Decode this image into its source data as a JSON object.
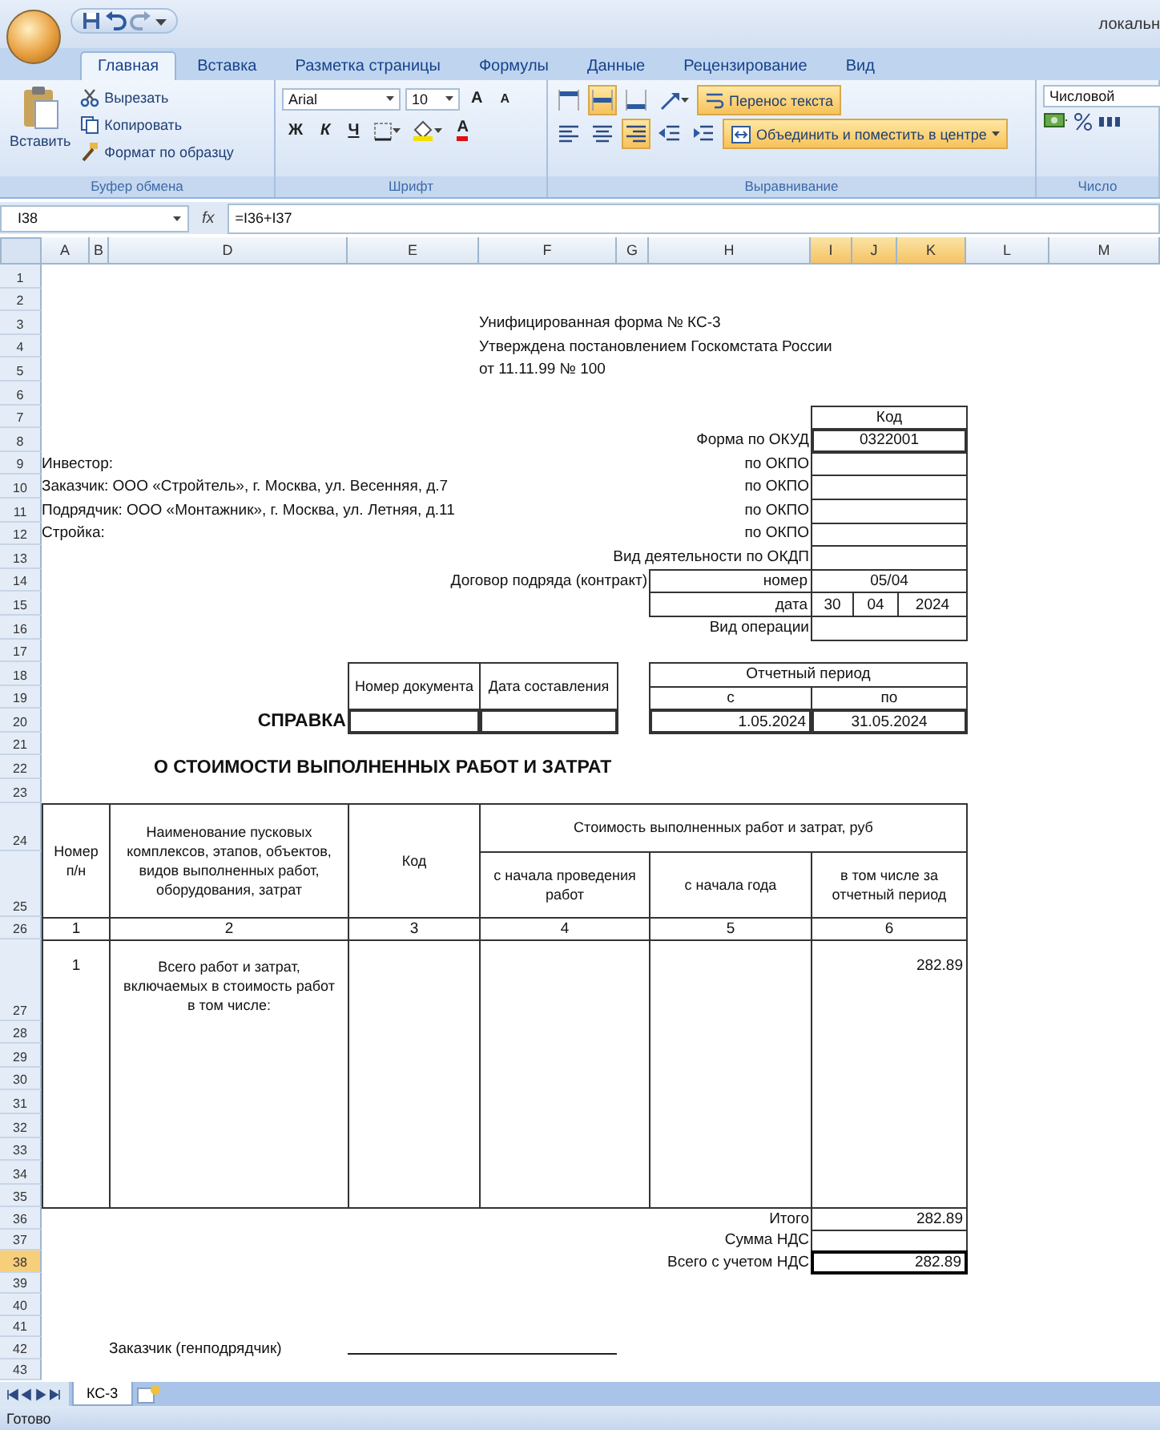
{
  "window": {
    "title": "локальн"
  },
  "ribbon": {
    "tabs": [
      {
        "label": "Главная",
        "selected": true
      },
      {
        "label": "Вставка",
        "selected": false
      },
      {
        "label": "Разметка страницы",
        "selected": false
      },
      {
        "label": "Формулы",
        "selected": false
      },
      {
        "label": "Данные",
        "selected": false
      },
      {
        "label": "Рецензирование",
        "selected": false
      },
      {
        "label": "Вид",
        "selected": false
      }
    ],
    "clipboard": {
      "paste": "Вставить",
      "commands": [
        "Вырезать",
        "Копировать",
        "Формат по образцу"
      ],
      "group": "Буфер обмена"
    },
    "font": {
      "name": "Arial",
      "size": "10",
      "grow": "A",
      "shrink": "A",
      "styles": [
        "Ж",
        "К",
        "Ч"
      ],
      "font_color_label": "A",
      "group": "Шрифт"
    },
    "alignment": {
      "vertical": [
        {
          "selected": false
        },
        {
          "selected": true
        },
        {
          "selected": false
        }
      ],
      "horizontal": [
        {
          "selected": false
        },
        {
          "selected": false
        },
        {
          "selected": true
        }
      ],
      "wrap": {
        "label": "Перенос текста",
        "selected": true
      },
      "merge": {
        "label": "Объединить и поместить в центре",
        "selected": true
      },
      "group": "Выравнивание"
    },
    "number": {
      "format": "Числовой",
      "group": "Число"
    }
  },
  "formula_bar": {
    "name_box": "I38",
    "function_label": "fx",
    "formula": "=I36+I37"
  },
  "columns": [
    {
      "label": "A",
      "selected": false
    },
    {
      "label": "B",
      "selected": false
    },
    {
      "label": "D",
      "selected": false
    },
    {
      "label": "E",
      "selected": false
    },
    {
      "label": "F",
      "selected": false
    },
    {
      "label": "G",
      "selected": false
    },
    {
      "label": "H",
      "selected": false
    },
    {
      "label": "I",
      "selected": true
    },
    {
      "label": "J",
      "selected": true
    },
    {
      "label": "K",
      "selected": true
    },
    {
      "label": "L",
      "selected": false
    },
    {
      "label": "M",
      "selected": false
    }
  ],
  "rows": [
    {
      "label": "1",
      "selected": false
    },
    {
      "label": "2",
      "selected": false
    },
    {
      "label": "3",
      "selected": false
    },
    {
      "label": "4",
      "selected": false
    },
    {
      "label": "5",
      "selected": false
    },
    {
      "label": "6",
      "selected": false
    },
    {
      "label": "7",
      "selected": false
    },
    {
      "label": "8",
      "selected": false
    },
    {
      "label": "9",
      "selected": false
    },
    {
      "label": "10",
      "selected": false
    },
    {
      "label": "11",
      "selected": false
    },
    {
      "label": "12",
      "selected": false
    },
    {
      "label": "13",
      "selected": false
    },
    {
      "label": "14",
      "selected": false
    },
    {
      "label": "15",
      "selected": false
    },
    {
      "label": "16",
      "selected": false
    },
    {
      "label": "17",
      "selected": false
    },
    {
      "label": "18",
      "selected": false
    },
    {
      "label": "19",
      "selected": false
    },
    {
      "label": "20",
      "selected": false
    },
    {
      "label": "21",
      "selected": false
    },
    {
      "label": "22",
      "selected": false
    },
    {
      "label": "23",
      "selected": false
    },
    {
      "label": "24",
      "selected": false
    },
    {
      "label": "25",
      "selected": false
    },
    {
      "label": "26",
      "selected": false
    },
    {
      "label": "27",
      "selected": false
    },
    {
      "label": "28",
      "selected": false
    },
    {
      "label": "29",
      "selected": false
    },
    {
      "label": "30",
      "selected": false
    },
    {
      "label": "31",
      "selected": false
    },
    {
      "label": "32",
      "selected": false
    },
    {
      "label": "33",
      "selected": false
    },
    {
      "label": "34",
      "selected": false
    },
    {
      "label": "35",
      "selected": false
    },
    {
      "label": "36",
      "selected": false
    },
    {
      "label": "37",
      "selected": false
    },
    {
      "label": "38",
      "selected": true
    },
    {
      "label": "39",
      "selected": false
    },
    {
      "label": "40",
      "selected": false
    },
    {
      "label": "41",
      "selected": false
    },
    {
      "label": "42",
      "selected": false
    },
    {
      "label": "43",
      "selected": false
    }
  ],
  "form": {
    "header": [
      "Унифицированная форма № КС-3",
      "Утверждена постановлением Госкомстата России",
      "от 11.11.99 № 100"
    ],
    "parties": [
      "Инвестор:",
      "Заказчик: ООО «Стройтель», г. Москва, ул. Весенняя, д.7",
      "Подрядчик: ООО «Монтажник», г. Москва, ул. Летняя, д.11",
      "Стройка:"
    ],
    "codes": {
      "title": "Код",
      "items": [
        {
          "label": "Форма по ОКУД",
          "value": "0322001"
        },
        {
          "label": "по ОКПО"
        },
        {
          "label": "по ОКПО"
        },
        {
          "label": "по ОКПО"
        },
        {
          "label": "по ОКПО"
        },
        {
          "label": "Вид деятельности по ОКДП"
        }
      ]
    },
    "contract": {
      "label": "Договор подряда (контракт)",
      "number_label": "номер",
      "number": "05/04",
      "date_label": "дата",
      "date": [
        "30",
        "04",
        "2024"
      ]
    },
    "operation": {
      "label": "Вид операции"
    },
    "title": "СПРАВКА",
    "document": {
      "columns": [
        "Номер документа",
        "Дата составления"
      ]
    },
    "period": {
      "title": "Отчетный период",
      "from_label": "с",
      "to_label": "по",
      "from": "1.05.2024",
      "to": "31.05.2024"
    },
    "subtitle": "О СТОИМОСТИ ВЫПОЛНЕННЫХ РАБОТ И ЗАТРАТ",
    "table": {
      "columns": [
        "Номер п/н",
        "Наименование пусковых комплексов, этапов, объектов, видов выполненных работ, оборудования, затрат",
        "Код"
      ],
      "cost_header": "Стоимость выполненных работ и затрат, руб",
      "cost_columns": [
        "с начала проведения работ",
        "с начала года",
        "в том числе за отчетный период"
      ],
      "numbers": [
        "1",
        "2",
        "3",
        "4",
        "5",
        "6"
      ],
      "rows": [
        {
          "number": "1",
          "name": "Всего работ и затрат, включаемых в стоимость работ в том числе:",
          "period": "282.89"
        }
      ]
    },
    "totals": [
      {
        "label": "Итого",
        "value": "282.89",
        "selected": false
      },
      {
        "label": "Сумма НДС",
        "selected": false
      },
      {
        "label": "Всего с учетом НДС",
        "value": "282.89",
        "selected": true
      }
    ],
    "signature": {
      "label": "Заказчик (генподрядчик)"
    }
  },
  "sheet_tabs": [
    {
      "label": "КС-3",
      "selected": true
    }
  ],
  "status_bar": {
    "text": "Готово"
  }
}
